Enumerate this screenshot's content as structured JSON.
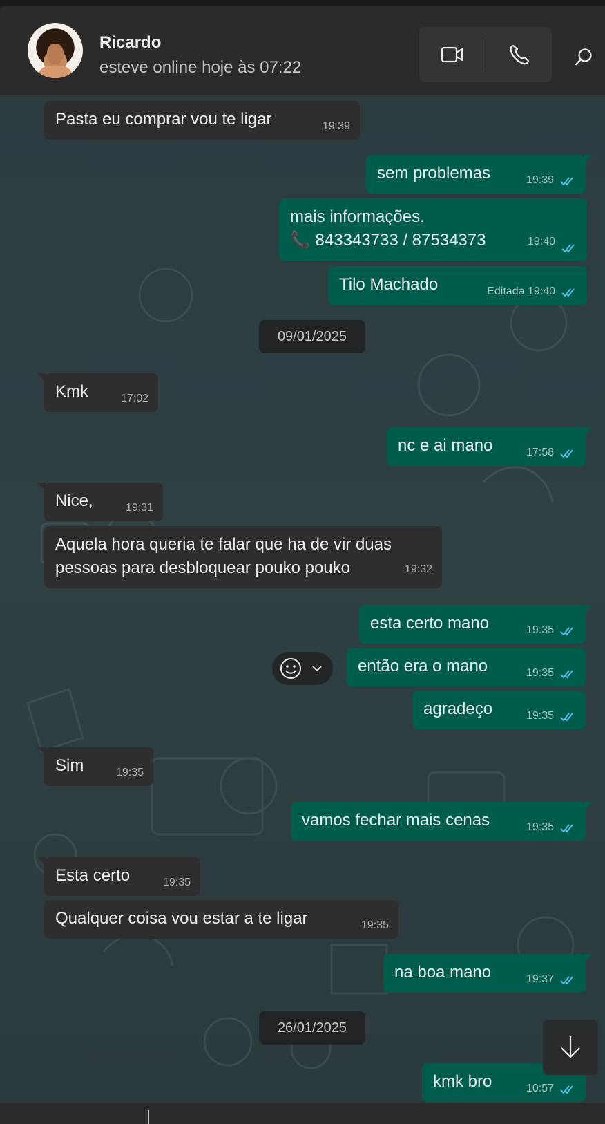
{
  "contact": {
    "name": "Ricardo",
    "status": "esteve online hoje às 07:22"
  },
  "header_icons": [
    "video-call-icon",
    "voice-call-icon",
    "search-icon"
  ],
  "colors": {
    "incoming_bubble": "#2e2e2e",
    "outgoing_bubble": "#005c4b",
    "read_ticks": "#53bdeb",
    "header": "#2b2b2b"
  },
  "dates": [
    "09/01/2025",
    "26/01/2025"
  ],
  "messages": [
    {
      "dir": "in",
      "text": "Pasta eu comprar vou te  ligar",
      "time": "19:39"
    },
    {
      "dir": "out",
      "text": "sem problemas",
      "time": "19:39",
      "read": true
    },
    {
      "dir": "out",
      "line1": "mais informações.",
      "line2": "📞 843343733 / 87534373",
      "time": "19:40",
      "read": true
    },
    {
      "dir": "out",
      "text": "Tilo Machado",
      "edited": "Editada",
      "time": "19:40",
      "read": true
    },
    {
      "dir": "in",
      "text": "Kmk",
      "time": "17:02"
    },
    {
      "dir": "out",
      "text": "nc e ai mano",
      "time": "17:58",
      "read": true
    },
    {
      "dir": "in",
      "text": "Nice,",
      "time": "19:31"
    },
    {
      "dir": "in",
      "line1": "Aquela hora queria te falar que ha de vir duas",
      "line2": "pessoas para desbloquear pouko pouko",
      "time": "19:32"
    },
    {
      "dir": "out",
      "text": "esta certo mano",
      "time": "19:35",
      "read": true
    },
    {
      "dir": "out",
      "text": "então era o mano",
      "time": "19:35",
      "read": true
    },
    {
      "dir": "out",
      "text": "agradeço",
      "time": "19:35",
      "read": true
    },
    {
      "dir": "in",
      "text": "Sim",
      "time": "19:35"
    },
    {
      "dir": "out",
      "text": "vamos fechar mais cenas",
      "time": "19:35",
      "read": true
    },
    {
      "dir": "in",
      "text": "Esta certo",
      "time": "19:35"
    },
    {
      "dir": "in",
      "text": "Qualquer coisa vou estar  a te ligar",
      "time": "19:35"
    },
    {
      "dir": "out",
      "text": "na boa mano",
      "time": "19:37",
      "read": true
    },
    {
      "dir": "out",
      "text": "kmk bro",
      "time": "10:57",
      "read": true
    }
  ]
}
